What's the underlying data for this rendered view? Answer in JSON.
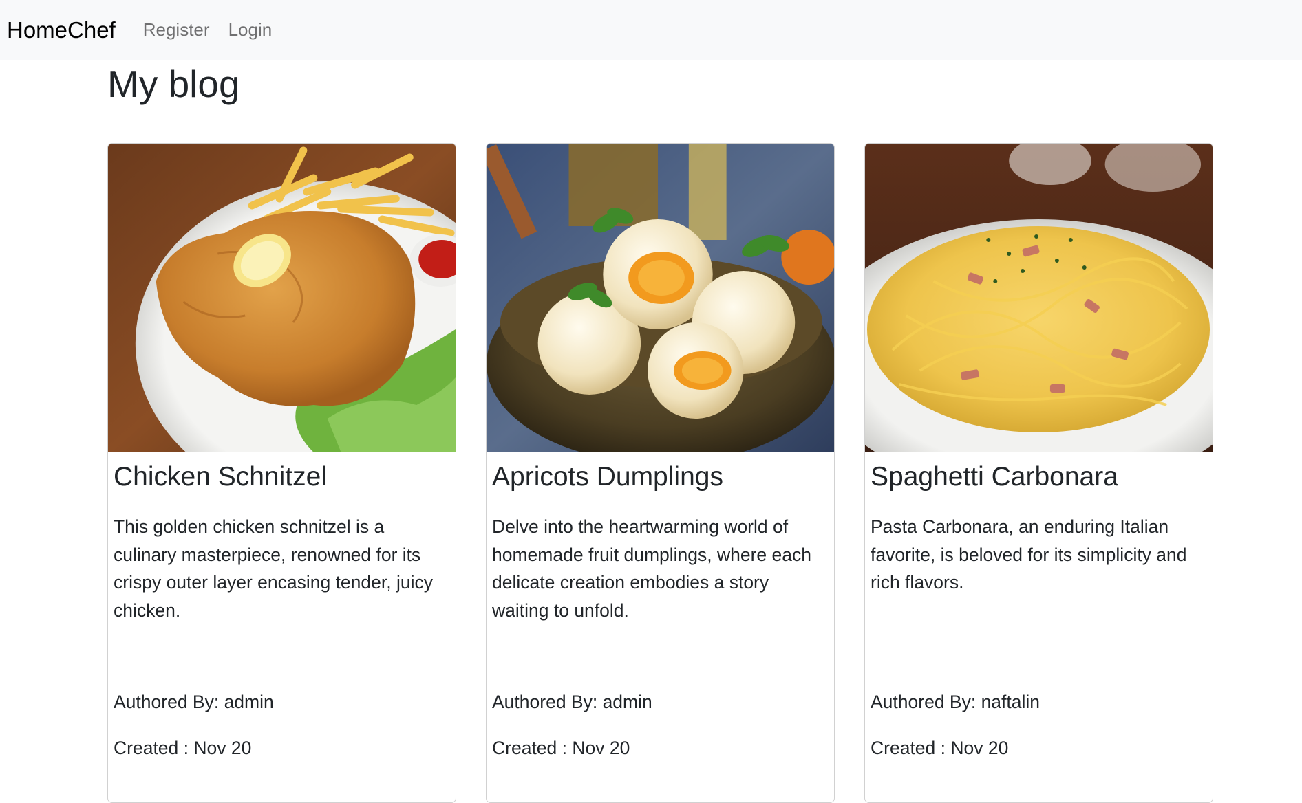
{
  "navbar": {
    "brand": "HomeChef",
    "links": [
      "Register",
      "Login"
    ]
  },
  "page": {
    "title": "My blog"
  },
  "posts": [
    {
      "title": "Chicken Schnitzel",
      "description": "This golden chicken schnitzel is a culinary masterpiece, renowned for its crispy outer layer encasing tender, juicy chicken.",
      "author": "Authored By: admin",
      "created": "Created : Nov 20"
    },
    {
      "title": "Apricots Dumplings",
      "description": "Delve into the heartwarming world of homemade fruit dumplings, where each delicate creation embodies a story waiting to unfold.",
      "author": "Authored By: admin",
      "created": "Created : Nov 20"
    },
    {
      "title": "Spaghetti Carbonara",
      "description": "Pasta Carbonara, an enduring Italian favorite, is beloved for its simplicity and rich flavors.",
      "author": "Authored By: naftalin",
      "created": "Created : Nov 20"
    }
  ]
}
